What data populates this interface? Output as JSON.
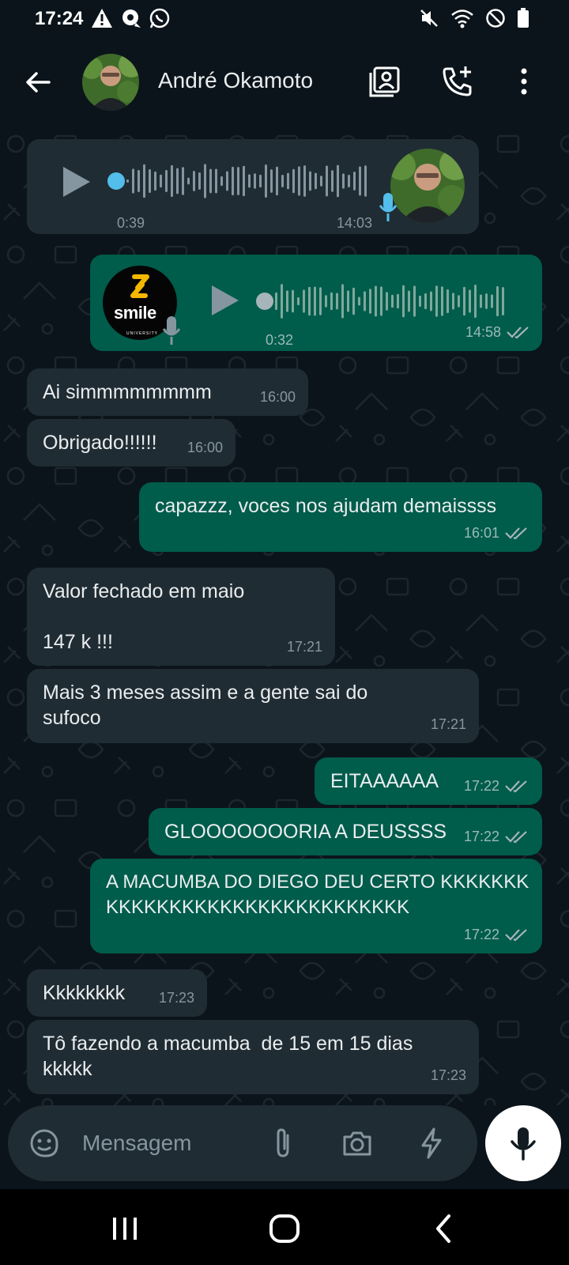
{
  "status_bar": {
    "time": "17:24",
    "left_icons": [
      "alert-icon",
      "chat-bubble-icon",
      "whatsapp-icon"
    ],
    "right_icons": [
      "mute-icon",
      "wifi-icon",
      "do-not-disturb-icon",
      "battery-icon"
    ]
  },
  "header": {
    "contact_name": "André Okamoto",
    "icons": [
      "back-arrow-icon",
      "contact-card-icon",
      "add-call-icon",
      "more-vertical-icon"
    ]
  },
  "messages": [
    {
      "dir": "in",
      "type": "voice",
      "duration": "0:39",
      "time": "14:03"
    },
    {
      "dir": "out",
      "type": "voice",
      "duration": "0:32",
      "time": "14:58",
      "avatar_label": "smile",
      "avatar_sublabel": "UNIVERSITY"
    },
    {
      "dir": "in",
      "type": "text",
      "text": "Ai simmmmmmmm",
      "time": "16:00"
    },
    {
      "dir": "in",
      "type": "text",
      "text": "Obrigado!!!!!!",
      "time": "16:00"
    },
    {
      "dir": "out",
      "type": "text",
      "text": "capazzz, voces nos ajudam demaissss",
      "time": "16:01"
    },
    {
      "dir": "in",
      "type": "text",
      "text": "Valor fechado em maio\n\n147 k !!!",
      "time": "17:21"
    },
    {
      "dir": "in",
      "type": "text",
      "text": "Mais 3 meses assim e a gente sai do sufoco",
      "time": "17:21"
    },
    {
      "dir": "out",
      "type": "text",
      "text": "EITAAAAAA",
      "time": "17:22"
    },
    {
      "dir": "out",
      "type": "text",
      "text": "GLOOOOOOORIA A DEUSSSS",
      "time": "17:22"
    },
    {
      "dir": "out",
      "type": "text",
      "text": "A MACUMBA DO DIEGO DEU CERTO KKKKKKKKKKKKKKKKKKKKKKKKKKKKKKK",
      "time": "17:22"
    },
    {
      "dir": "in",
      "type": "text",
      "text": "Kkkkkkkk",
      "time": "17:23"
    },
    {
      "dir": "in",
      "type": "text",
      "text": "Tô fazendo a macumba  de 15 em 15 dias kkkkk",
      "time": "17:23"
    }
  ],
  "composer": {
    "placeholder": "Mensagem",
    "icons": [
      "sticker-icon",
      "attach-icon",
      "camera-icon",
      "lightning-icon",
      "mic-icon"
    ]
  },
  "nav_bar": {
    "icons": [
      "recent-apps-icon",
      "home-icon",
      "back-icon"
    ]
  },
  "colors": {
    "background": "#0b141a",
    "incoming_bubble": "#202c33",
    "outgoing_bubble": "#005c4b",
    "accent_blue": "#53bdeb"
  }
}
